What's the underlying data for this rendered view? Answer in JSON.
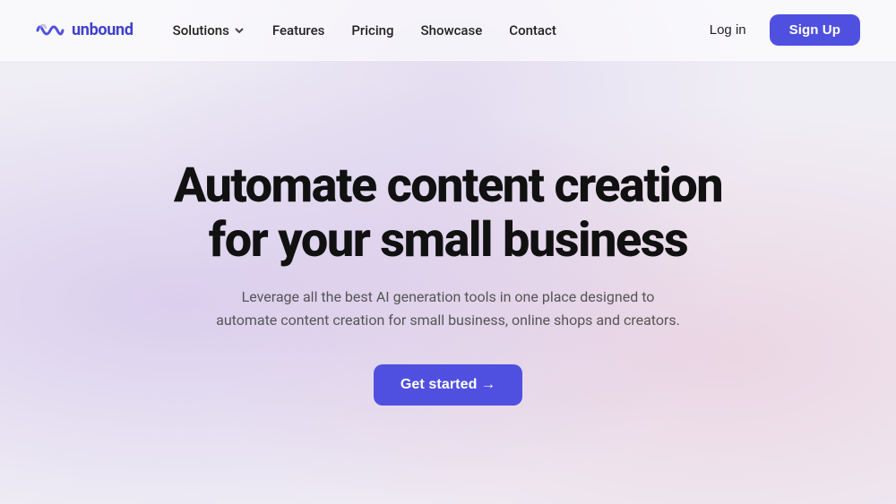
{
  "brand": {
    "logo_text": "unbound",
    "logo_icon_alt": "unbound logo"
  },
  "nav": {
    "links": [
      {
        "label": "Solutions",
        "has_dropdown": true
      },
      {
        "label": "Features",
        "has_dropdown": false
      },
      {
        "label": "Pricing",
        "has_dropdown": false
      },
      {
        "label": "Showcase",
        "has_dropdown": false
      },
      {
        "label": "Contact",
        "has_dropdown": false
      }
    ],
    "login_label": "Log in",
    "signup_label": "Sign Up"
  },
  "hero": {
    "title_line1": "Automate content creation",
    "title_line2": "for your small business",
    "subtitle": "Leverage all the best AI generation tools in one place designed to automate content creation for small business, online shops and creators.",
    "cta_label": "Get started →"
  },
  "colors": {
    "brand_blue": "#5050e0",
    "text_dark": "#111111",
    "text_muted": "#555555"
  }
}
